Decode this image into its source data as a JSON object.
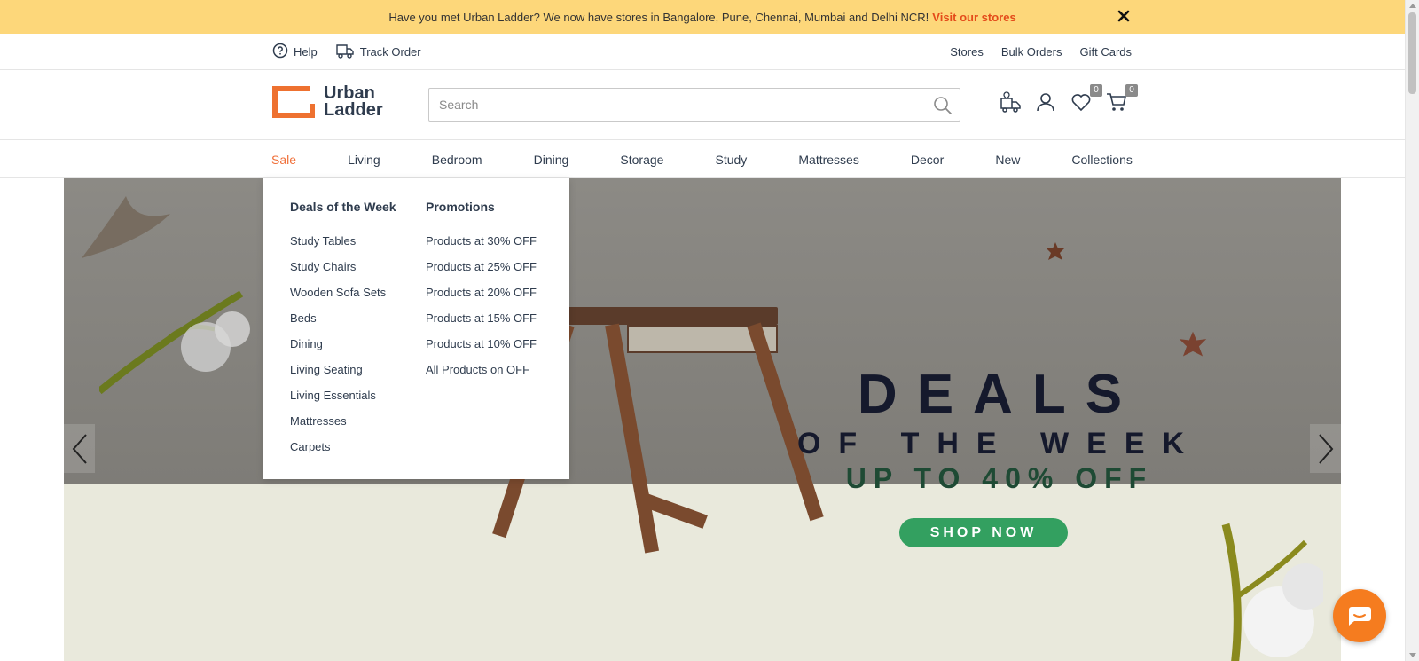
{
  "announcement": {
    "text": "Have you met Urban Ladder? We now have stores in Bangalore, Pune, Chennai, Mumbai and Delhi NCR!",
    "link": "Visit our stores"
  },
  "utility": {
    "help": "Help",
    "track_order": "Track Order",
    "right_links": [
      "Stores",
      "Bulk Orders",
      "Gift Cards"
    ]
  },
  "header": {
    "logo_line1": "Urban",
    "logo_line2": "Ladder",
    "search_placeholder": "Search",
    "wishlist_count": "0",
    "cart_count": "0"
  },
  "nav": {
    "items": [
      "Sale",
      "Living",
      "Bedroom",
      "Dining",
      "Storage",
      "Study",
      "Mattresses",
      "Decor",
      "New",
      "Collections"
    ],
    "active": "Sale"
  },
  "mega_menu": {
    "col1": {
      "heading": "Deals of the Week",
      "items": [
        "Study Tables",
        "Study Chairs",
        "Wooden Sofa Sets",
        "Beds",
        "Dining",
        "Living Seating",
        "Living Essentials",
        "Mattresses",
        "Carpets"
      ]
    },
    "col2": {
      "heading": "Promotions",
      "items": [
        "Products at 30% OFF",
        "Products at 25% OFF",
        "Products at 20% OFF",
        "Products at 15% OFF",
        "Products at 10% OFF",
        "All Products on OFF"
      ]
    }
  },
  "hero": {
    "title": "DEALS",
    "subtitle": "OF THE WEEK",
    "offer": "UP TO 40% OFF",
    "cta": "SHOP NOW"
  },
  "colors": {
    "announcement_bg": "#fdd77a",
    "accent": "#f0703a",
    "cta_green": "#33a060",
    "chat": "#f57c1f"
  }
}
